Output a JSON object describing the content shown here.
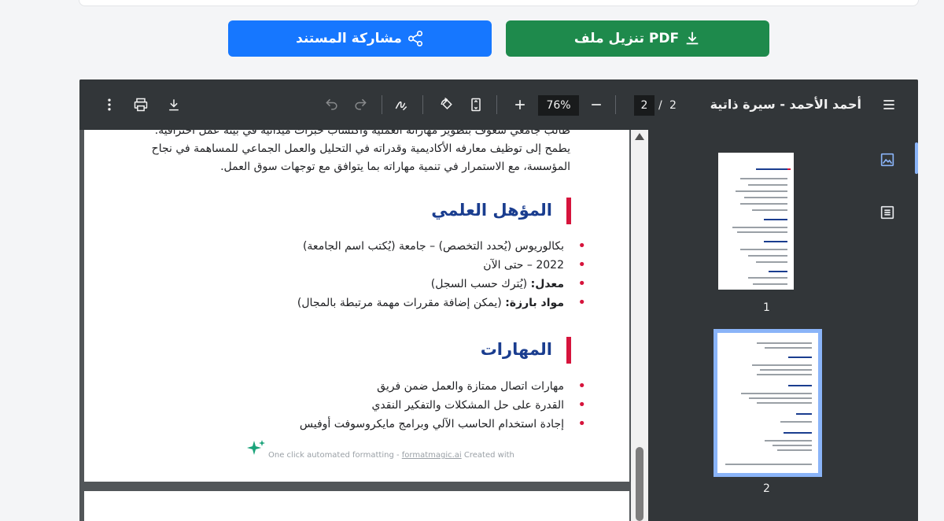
{
  "share_button": {
    "label": "مشاركة المستند",
    "icon": "share-icon",
    "color": "#1677ff"
  },
  "download_button": {
    "label": "تنزيل ملف PDF",
    "icon": "download-icon",
    "color": "#1e8a4c"
  },
  "toolbar": {
    "title": "أحمد الأحمد - سيرة ذاتية",
    "current_page": "2",
    "page_separator": "/",
    "total_pages": "2",
    "zoom": "76%"
  },
  "page": {
    "intro_lines": [
      "طالب جامعي شغوف بتطوير مهاراته العملية واكتساب خبرات ميدانية في بيئة عمل احترافية.",
      "يطمح إلى توظيف معارفه الأكاديمية وقدراته في التحليل والعمل الجماعي للمساهمة في نجاح",
      "المؤسسة، مع الاستمرار في تنمية مهاراته بما يتوافق مع توجهات سوق العمل."
    ],
    "education": {
      "heading": "المؤهل العلمي",
      "items": [
        {
          "text": "بكالوريوس (يُحدد التخصص) – جامعة (يُكتب اسم الجامعة)"
        },
        {
          "text": "2022 – حتى الآن"
        },
        {
          "label": "معدل:",
          "text": " (يُترك حسب السجل)"
        },
        {
          "label": "مواد بارزة:",
          "text": " (يمكن إضافة مقررات مهمة مرتبطة بالمجال)"
        }
      ]
    },
    "skills": {
      "heading": "المهارات",
      "items": [
        "مهارات اتصال ممتازة والعمل ضمن فريق",
        "القدرة على حل المشكلات والتفكير النقدي",
        "إجادة استخدام الحاسب الآلي وبرامج مايكروسوفت أوفيس"
      ]
    },
    "footer": {
      "prefix": "One click automated formatting - ",
      "link": "formatmagic.ai",
      "suffix": " Created with"
    }
  },
  "thumbnails": [
    {
      "label": "1",
      "selected": false
    },
    {
      "label": "2",
      "selected": true
    }
  ],
  "colors": {
    "heading": "#1a3d8f",
    "accent": "#d6143c",
    "toolbar": "#323639",
    "viewer_bg": "#525659"
  }
}
